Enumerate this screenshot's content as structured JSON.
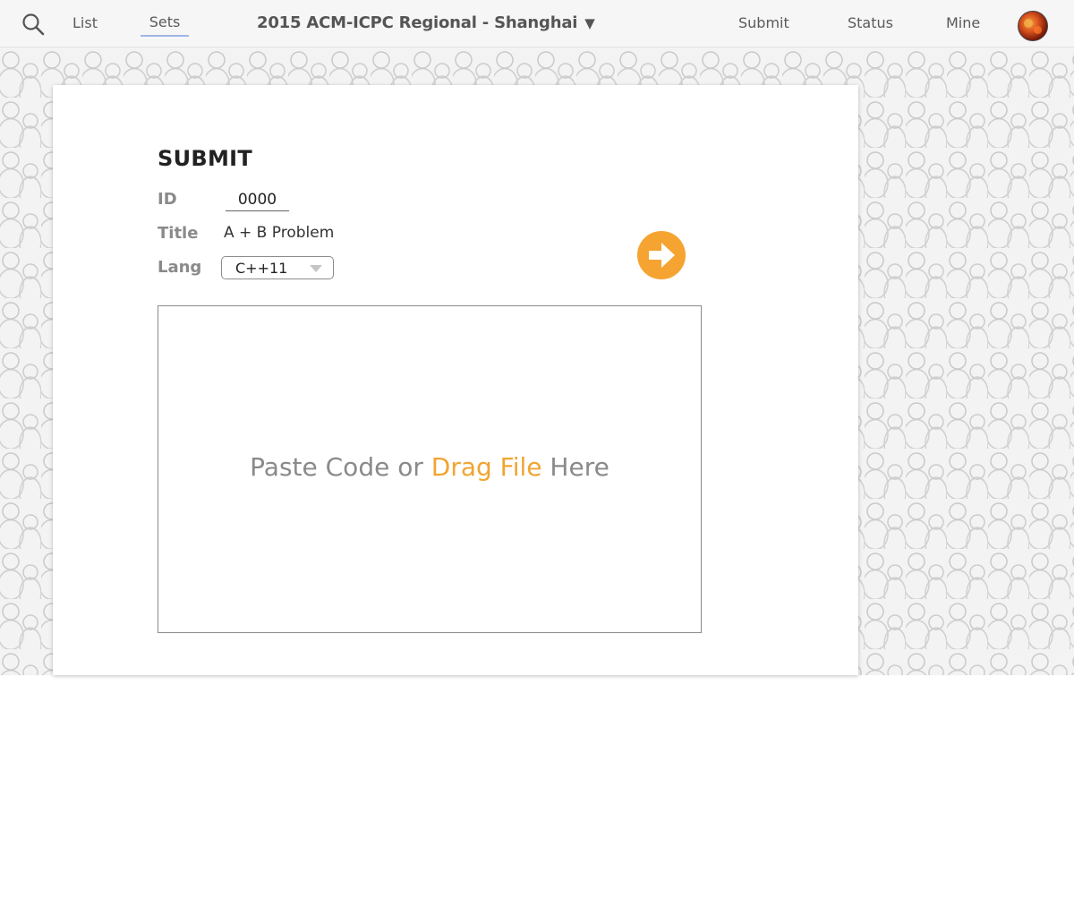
{
  "nav": {
    "list_label": "List",
    "sets_label": "Sets",
    "contest_title": "2015 ACM-ICPC Regional - Shanghai",
    "contest_caret": "▼",
    "submit_label": "Submit",
    "status_label": "Status",
    "mine_label": "Mine",
    "search_icon": "search-icon",
    "avatar": "user-avatar"
  },
  "submit_form": {
    "heading": "SUBMIT",
    "id_label": "ID",
    "id_value": "0000",
    "title_label": "Title",
    "title_value": "A + B Problem",
    "lang_label": "Lang",
    "lang_value": "C++11",
    "submit_icon": "arrow-right-circle-icon",
    "code_hint_pre": "Paste Code or ",
    "code_hint_accent": "Drag File",
    "code_hint_post": " Here"
  },
  "colors": {
    "accent": "#f5a431",
    "active_tab_underline": "#9fb7e8",
    "muted_label": "#8a8a8a"
  }
}
